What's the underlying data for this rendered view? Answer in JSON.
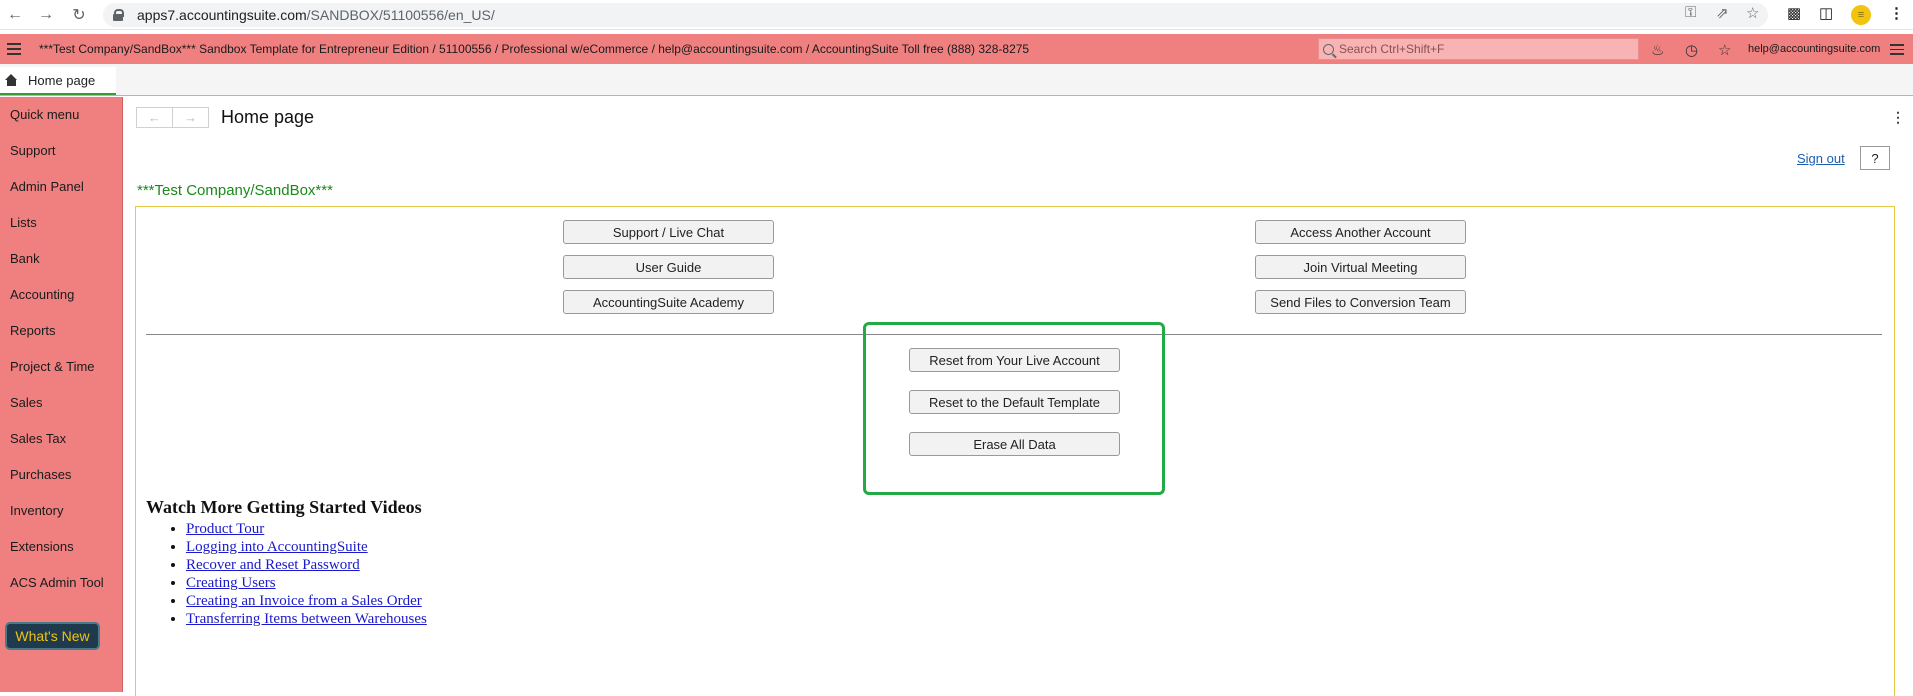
{
  "browser": {
    "url_host": "apps7.accountingsuite.com",
    "url_path": "/SANDBOX/51100556/en_US/"
  },
  "header": {
    "title": "***Test Company/SandBox*** Sandbox Template for Entrepreneur Edition / 51100556 / Professional w/eCommerce / help@accountingsuite.com / AccountingSuite Toll free (888) 328-8275",
    "search_placeholder": "Search Ctrl+Shift+F",
    "user_email": "help@accountingsuite.com"
  },
  "tabs": [
    {
      "label": "Home page",
      "active": true
    }
  ],
  "sidebar": {
    "items": [
      {
        "label": "Quick menu"
      },
      {
        "label": "Support"
      },
      {
        "label": "Admin Panel"
      },
      {
        "label": "Lists"
      },
      {
        "label": "Bank"
      },
      {
        "label": "Accounting"
      },
      {
        "label": "Reports"
      },
      {
        "label": "Project & Time"
      },
      {
        "label": "Sales"
      },
      {
        "label": "Sales Tax"
      },
      {
        "label": "Purchases"
      },
      {
        "label": "Inventory"
      },
      {
        "label": "Extensions"
      },
      {
        "label": "ACS Admin Tool"
      }
    ],
    "whats_new_label": "What's New"
  },
  "main": {
    "page_title": "Home page",
    "sign_out_label": "Sign out",
    "help_label": "?",
    "company_name": "***Test Company/SandBox***",
    "left_buttons": [
      "Support / Live Chat",
      "User Guide",
      "AccountingSuite Academy"
    ],
    "right_buttons": [
      "Access Another Account",
      "Join Virtual Meeting",
      "Send Files to Conversion Team"
    ],
    "reset_buttons": [
      "Reset from Your Live Account",
      "Reset to the Default Template",
      "Erase All Data"
    ],
    "videos_title": "Watch More Getting Started Videos",
    "videos": [
      "Product Tour",
      "Logging into AccountingSuite",
      "Recover and Reset Password",
      "Creating Users",
      "Creating an Invoice from a Sales Order",
      "Transferring Items between Warehouses"
    ]
  },
  "colors": {
    "header_bg": "#f08080",
    "sidebar_bg": "#f08080",
    "company_text": "#1a8a1a",
    "highlight_border": "#22aa44",
    "whats_new_bg": "#1f3a4d",
    "whats_new_text": "#f1c40f"
  },
  "icons": [
    "back-icon",
    "forward-icon",
    "reload-icon",
    "lock-icon",
    "key-icon",
    "share-icon",
    "star-icon",
    "extensions-icon",
    "sidebar-icon",
    "menu-icon",
    "search-icon",
    "bell-icon",
    "history-icon",
    "favorite-icon",
    "home-icon",
    "kebab-icon"
  ]
}
